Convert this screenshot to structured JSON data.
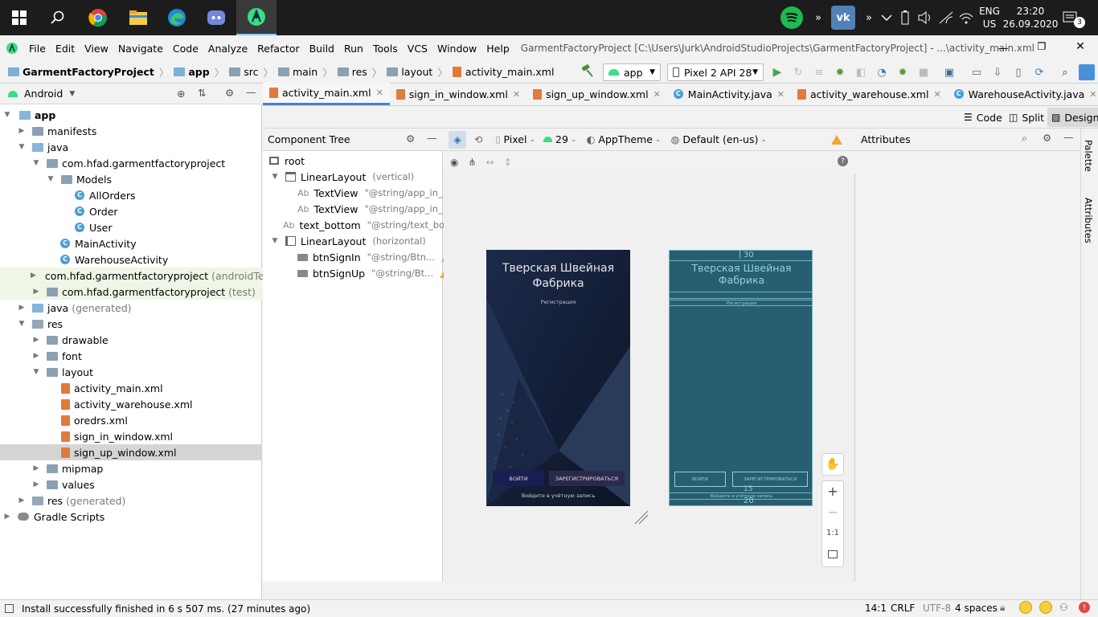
{
  "taskbar": {
    "clock_time": "23:20",
    "clock_date": "26.09.2020",
    "lang_top": "ENG",
    "lang_bottom": "US",
    "notif_count": "3"
  },
  "menubar": {
    "items": [
      "File",
      "Edit",
      "View",
      "Navigate",
      "Code",
      "Analyze",
      "Refactor",
      "Build",
      "Run",
      "Tools",
      "VCS",
      "Window",
      "Help"
    ],
    "title": "GarmentFactoryProject [C:\\Users\\Jurk\\AndroidStudioProjects\\GarmentFactoryProject] - ...\\activity_main.xml [app]"
  },
  "navbar": {
    "crumbs": [
      "GarmentFactoryProject",
      "app",
      "src",
      "main",
      "res",
      "layout",
      "activity_main.xml"
    ],
    "run_config": "app",
    "device": "Pixel 2 API 28"
  },
  "project": {
    "view_mode": "Android",
    "tree": [
      {
        "label": "app",
        "extra": ""
      },
      {
        "label": "manifests",
        "extra": ""
      },
      {
        "label": "java",
        "extra": ""
      },
      {
        "label": "com.hfad.garmentfactoryproject",
        "extra": ""
      },
      {
        "label": "Models",
        "extra": ""
      },
      {
        "label": "AllOrders",
        "extra": ""
      },
      {
        "label": "Order",
        "extra": ""
      },
      {
        "label": "User",
        "extra": ""
      },
      {
        "label": "MainActivity",
        "extra": ""
      },
      {
        "label": "WarehouseActivity",
        "extra": ""
      },
      {
        "label": "com.hfad.garmentfactoryproject",
        "extra": "(androidTest)"
      },
      {
        "label": "com.hfad.garmentfactoryproject",
        "extra": "(test)"
      },
      {
        "label": "java",
        "extra": "(generated)"
      },
      {
        "label": "res",
        "extra": ""
      },
      {
        "label": "drawable",
        "extra": ""
      },
      {
        "label": "font",
        "extra": ""
      },
      {
        "label": "layout",
        "extra": ""
      },
      {
        "label": "activity_main.xml",
        "extra": ""
      },
      {
        "label": "activity_warehouse.xml",
        "extra": ""
      },
      {
        "label": "oredrs.xml",
        "extra": ""
      },
      {
        "label": "sign_in_window.xml",
        "extra": ""
      },
      {
        "label": "sign_up_window.xml",
        "extra": ""
      },
      {
        "label": "mipmap",
        "extra": ""
      },
      {
        "label": "values",
        "extra": ""
      },
      {
        "label": "res",
        "extra": "(generated)"
      },
      {
        "label": "Gradle Scripts",
        "extra": ""
      }
    ]
  },
  "tabs": [
    "activity_main.xml",
    "sign_in_window.xml",
    "sign_up_window.xml",
    "MainActivity.java",
    "activity_warehouse.xml",
    "WarehouseActivity.java",
    "Al"
  ],
  "modes": {
    "code": "Code",
    "split": "Split",
    "design": "Design"
  },
  "component_tree": {
    "title": "Component Tree",
    "items": [
      {
        "name": "root",
        "sub": ""
      },
      {
        "name": "LinearLayout",
        "sub": "(vertical)"
      },
      {
        "name": "TextView",
        "sub": "\"@string/app_in_..."
      },
      {
        "name": "TextView",
        "sub": "\"@string/app_in_..."
      },
      {
        "name": "text_bottom",
        "sub": "\"@string/text_bo..."
      },
      {
        "name": "LinearLayout",
        "sub": "(horizontal)"
      },
      {
        "name": "btnSignIn",
        "sub": "\"@string/Btn..."
      },
      {
        "name": "btnSignUp",
        "sub": "\"@string/Bt..."
      }
    ]
  },
  "design_toolbar": {
    "device": "Pixel",
    "api": "29",
    "theme": "AppTheme",
    "locale": "Default (en-us)"
  },
  "attributes": {
    "title": "Attributes"
  },
  "side_strip": {
    "palette": "Palette",
    "attributes": "Attributes"
  },
  "preview": {
    "title": "Тверская Швейная Фабрика",
    "subtitle": "Регистрация",
    "btn_sign_in": "ВОЙТИ",
    "btn_sign_up": "ЗАРЕГИСТРИРОВАТЬСЯ",
    "bottom_text": "Войдите в учётную запись",
    "margin_top": "30",
    "margin_mid": "15",
    "margin_bottom": "20"
  },
  "zoom": {
    "one_to_one": "1:1"
  },
  "status": {
    "message": "Install successfully finished in 6 s 507 ms. (27 minutes ago)",
    "position": "14:1",
    "line_sep": "CRLF",
    "encoding": "UTF-8",
    "indent": "4 spaces"
  },
  "colors": {
    "accent": "#4083c9",
    "blueprint": "#275f70",
    "warning": "#f0a732"
  }
}
